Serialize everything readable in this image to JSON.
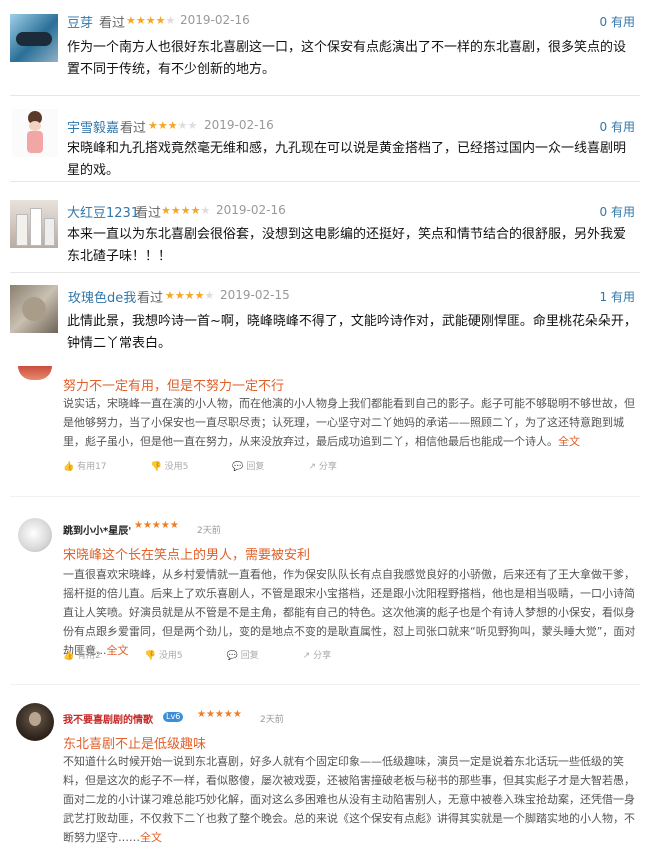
{
  "douban_reviews": [
    {
      "user": "豆芽",
      "seen": "看过",
      "rating": 4,
      "date": "2019-02-16",
      "useful": "0 有用",
      "text": "作为一个南方人也很好东北喜剧这一口，这个保安有点彪演出了不一样的东北喜剧，很多笑点的设置不同于传统，有不少创新的地方。"
    },
    {
      "user": "宇雪毅嘉",
      "seen": "看过",
      "rating": 3,
      "date": "2019-02-16",
      "useful": "0 有用",
      "text": "宋晓峰和九孔搭戏竟然毫无维和感，九孔现在可以说是黄金搭档了，已经搭过国内一众一线喜剧明星的戏。"
    },
    {
      "user": "大红豆1231",
      "seen": "看过",
      "rating": 4,
      "date": "2019-02-16",
      "useful": "0 有用",
      "text": "本来一直以为东北喜剧会很俗套，没想到这电影编的还挺好，笑点和情节结合的很舒服，另外我爱东北碴子味！！！"
    },
    {
      "user": "玫瑰色de我",
      "seen": "看过",
      "rating": 4,
      "date": "2019-02-15",
      "useful": "1 有用",
      "text": "此情此景，我想吟诗一首~啊，晓峰晓峰不得了，文能吟诗作对，武能硬刚悍匪。命里桃花朵朵开，钟情二丫常表白。"
    }
  ],
  "long_reviews": [
    {
      "user": "",
      "time": "",
      "title": "努力不一定有用，但是不努力一定不行",
      "text": "说实话，宋晓峰一直在演的小人物，而在他演的小人物身上我们都能看到自己的影子。彪子可能不够聪明不够世故，但是他够努力，当了小保安也一直尽职尽责；认死理，一心坚守对二丫她妈的承诺——照顾二丫，为了这还特意跑到城里，彪子虽小，但是他一直在努力，从来没放弃过，最后成功追到二丫，相信他最后也能成一个诗人。",
      "more": "全文",
      "actions": [
        "有用17",
        "没用5",
        "回复",
        "分享"
      ]
    },
    {
      "user": "跳到小小*星辰'",
      "time": "2天前",
      "title": "宋晓峰这个长在笑点上的男人，需要被安利",
      "text": "一直很喜欢宋晓峰，从乡村爱情就一直看他，作为保安队队长有点自我感觉良好的小骄傲，后来还有了王大拿做干爹，摇杆挺的倍儿直。后来上了欢乐喜剧人，不管是跟宋小宝搭档，还是跟小沈阳程野搭档，他也是相当吸睛，一口小诗简直让人笑喷。好演员就是从不管是不是主角，都能有自己的特色。这次他演的彪子也是个有诗人梦想的小保安，看似身份有点跟乡爱雷同，但是两个劲儿，变的是地点不变的是耿直属性，怼上司张口就来“听见野狗叫，蒙头睡大觉”，面对劫匪竟...",
      "more": "全文",
      "actions": [
        "有用2",
        "没用5",
        "回复",
        "分享"
      ]
    },
    {
      "user": "我不要喜剧剧的情歌",
      "vip": "Lv6",
      "time": "2天前",
      "title": "东北喜剧不止是低级趣味",
      "text": "不知道什么时候开始一说到东北喜剧，好多人就有个固定印象——低级趣味，演员一定是说着东北话玩一些低级的笑料，但是这次的彪子不一样，看似憨傻，屡次被戏耍，还被陷害撞破老板与秘书的那些事，但其实彪子才是大智若愚，面对二龙的小计谋刁难总能巧妙化解，面对这么多困难也从没有主动陷害别人，无意中被卷入珠宝抢劫案，还凭借一身武艺打败劫匪，不仅救下二丫也救了整个晚会。总的来说《这个保安有点彪》讲得其实就是一个脚踏实地的小人物，不断努力坚守……",
      "more": "全文"
    }
  ]
}
